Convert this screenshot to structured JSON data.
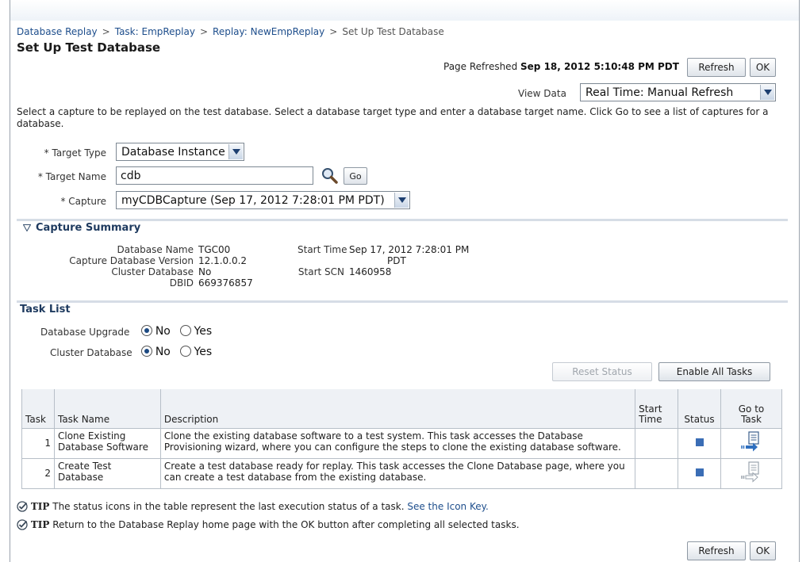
{
  "breadcrumb": {
    "items": [
      "Database Replay",
      "Task: EmpReplay",
      "Replay: NewEmpReplay"
    ],
    "separator": ">",
    "current": "Set Up Test Database"
  },
  "page": {
    "title": "Set Up Test Database"
  },
  "header": {
    "refreshed_label": "Page Refreshed",
    "refreshed_value": "Sep 18, 2012 5:10:48 PM PDT",
    "refresh_button": "Refresh",
    "ok_button": "OK",
    "view_data_label": "View Data",
    "view_data_value": "Real Time: Manual Refresh"
  },
  "instructions": "Select a capture to be replayed on the test database. Select a database target type and enter a database target name. Click Go to see a list of captures for a database.",
  "form": {
    "required_mark": "*",
    "target_type_label": "Target Type",
    "target_type_value": "Database Instance",
    "target_name_label": "Target Name",
    "target_name_value": "cdb",
    "go_button": "Go",
    "capture_label": "Capture",
    "capture_value": "myCDBCapture (Sep 17, 2012 7:28:01 PM PDT)"
  },
  "capture_summary": {
    "title": "Capture Summary",
    "left": [
      {
        "label": "Database Name",
        "value": "TGC00"
      },
      {
        "label": "Capture Database Version",
        "value": "12.1.0.0.2"
      },
      {
        "label": "Cluster Database",
        "value": "No"
      },
      {
        "label": "DBID",
        "value": "669376857"
      }
    ],
    "start_time_label": "Start Time",
    "start_time_line1": "Sep 17, 2012 7:28:01 PM",
    "start_time_line2": "PDT",
    "start_scn_label": "Start SCN",
    "start_scn_value": "1460958"
  },
  "task_list": {
    "title": "Task List",
    "db_upgrade_label": "Database Upgrade",
    "cluster_db_label": "Cluster Database",
    "no": "No",
    "yes": "Yes",
    "reset_status_button": "Reset Status",
    "enable_all_button": "Enable All Tasks",
    "columns": {
      "task": "Task",
      "task_name": "Task Name",
      "description": "Description",
      "start_time_1": "Start",
      "start_time_2": "Time",
      "status": "Status",
      "go_to_task_1": "Go to",
      "go_to_task_2": "Task"
    },
    "rows": [
      {
        "num": "1",
        "name_1": "Clone Existing",
        "name_2": "Database Software",
        "desc_1": "Clone the existing database software to a test system. This task accesses the Database",
        "desc_2": "Provisioning wizard, where you can configure the steps to clone the existing database software."
      },
      {
        "num": "2",
        "name_1": "Create Test",
        "name_2": "Database",
        "desc_1": "Create a test database ready for replay. This task accesses the Clone Database page, where you",
        "desc_2": "can create a test database from the existing database."
      }
    ]
  },
  "tips": {
    "tip_word": "TIP",
    "tip1_text": "The status icons in the table represent the last execution status of a task.",
    "tip1_link": "See the Icon Key.",
    "tip2_text": "Return to the Database Replay home page with the OK button after completing all selected tasks."
  },
  "footer": {
    "refresh_button": "Refresh",
    "ok_button": "OK"
  },
  "colors": {
    "link": "#1e4e8c",
    "section_title": "#1e3a5f",
    "status": "#3a6db5"
  }
}
